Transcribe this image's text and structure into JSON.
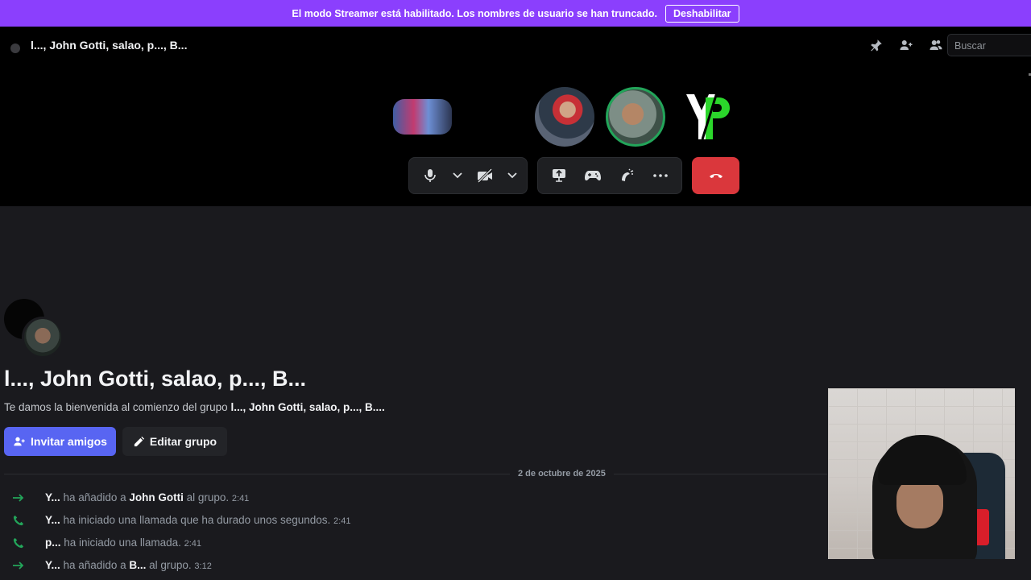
{
  "streamer_banner": {
    "message": "El modo Streamer está habilitado. Los nombres de usuario se han truncado.",
    "button_label": "Deshabilitar",
    "color": "#8b3ffd"
  },
  "header": {
    "title": "l..., John Gotti, salao, p..., B...",
    "icons": [
      "pin-icon",
      "add-member-icon",
      "members-icon"
    ],
    "search_placeholder": "Buscar"
  },
  "call": {
    "tiles": [
      "camera-tile",
      "avatar-1",
      "avatar-2-speaking",
      "yp-logo-avatar"
    ],
    "logo_text": "YP",
    "controls": [
      "microphone-icon",
      "camera-off-icon",
      "screen-share-icon",
      "activities-icon",
      "soundboard-icon",
      "more-icon",
      "hang-up-icon"
    ],
    "hangup_color": "#da373c",
    "speaking_color": "#23a55a"
  },
  "group": {
    "title": "l..., John Gotti, salao, p..., B...",
    "welcome_prefix": "Te damos la bienvenida al comienzo del grupo ",
    "welcome_name": "l..., John Gotti, salao, p..., B....",
    "invite_label": "Invitar amigos",
    "edit_label": "Editar grupo"
  },
  "divider_date": "2 de octubre de 2025",
  "messages": [
    {
      "icon": "arrow-right-icon",
      "user": "Y...",
      "pre": " ha añadido a ",
      "target": "John Gotti",
      "post": " al grupo. ",
      "time": "2:41"
    },
    {
      "icon": "phone-icon",
      "user": "Y...",
      "pre": " ha iniciado una llamada que ha durado unos segundos. ",
      "target": "",
      "post": "",
      "time": "2:41"
    },
    {
      "icon": "phone-icon",
      "user": "p...",
      "pre": " ha iniciado una llamada. ",
      "target": "",
      "post": "",
      "time": "2:41"
    },
    {
      "icon": "arrow-right-icon",
      "user": "Y...",
      "pre": " ha añadido a ",
      "target": "B...",
      "post": " al grupo. ",
      "time": "3:12"
    }
  ],
  "colors": {
    "accent": "#5865f2",
    "green": "#23a55a"
  }
}
